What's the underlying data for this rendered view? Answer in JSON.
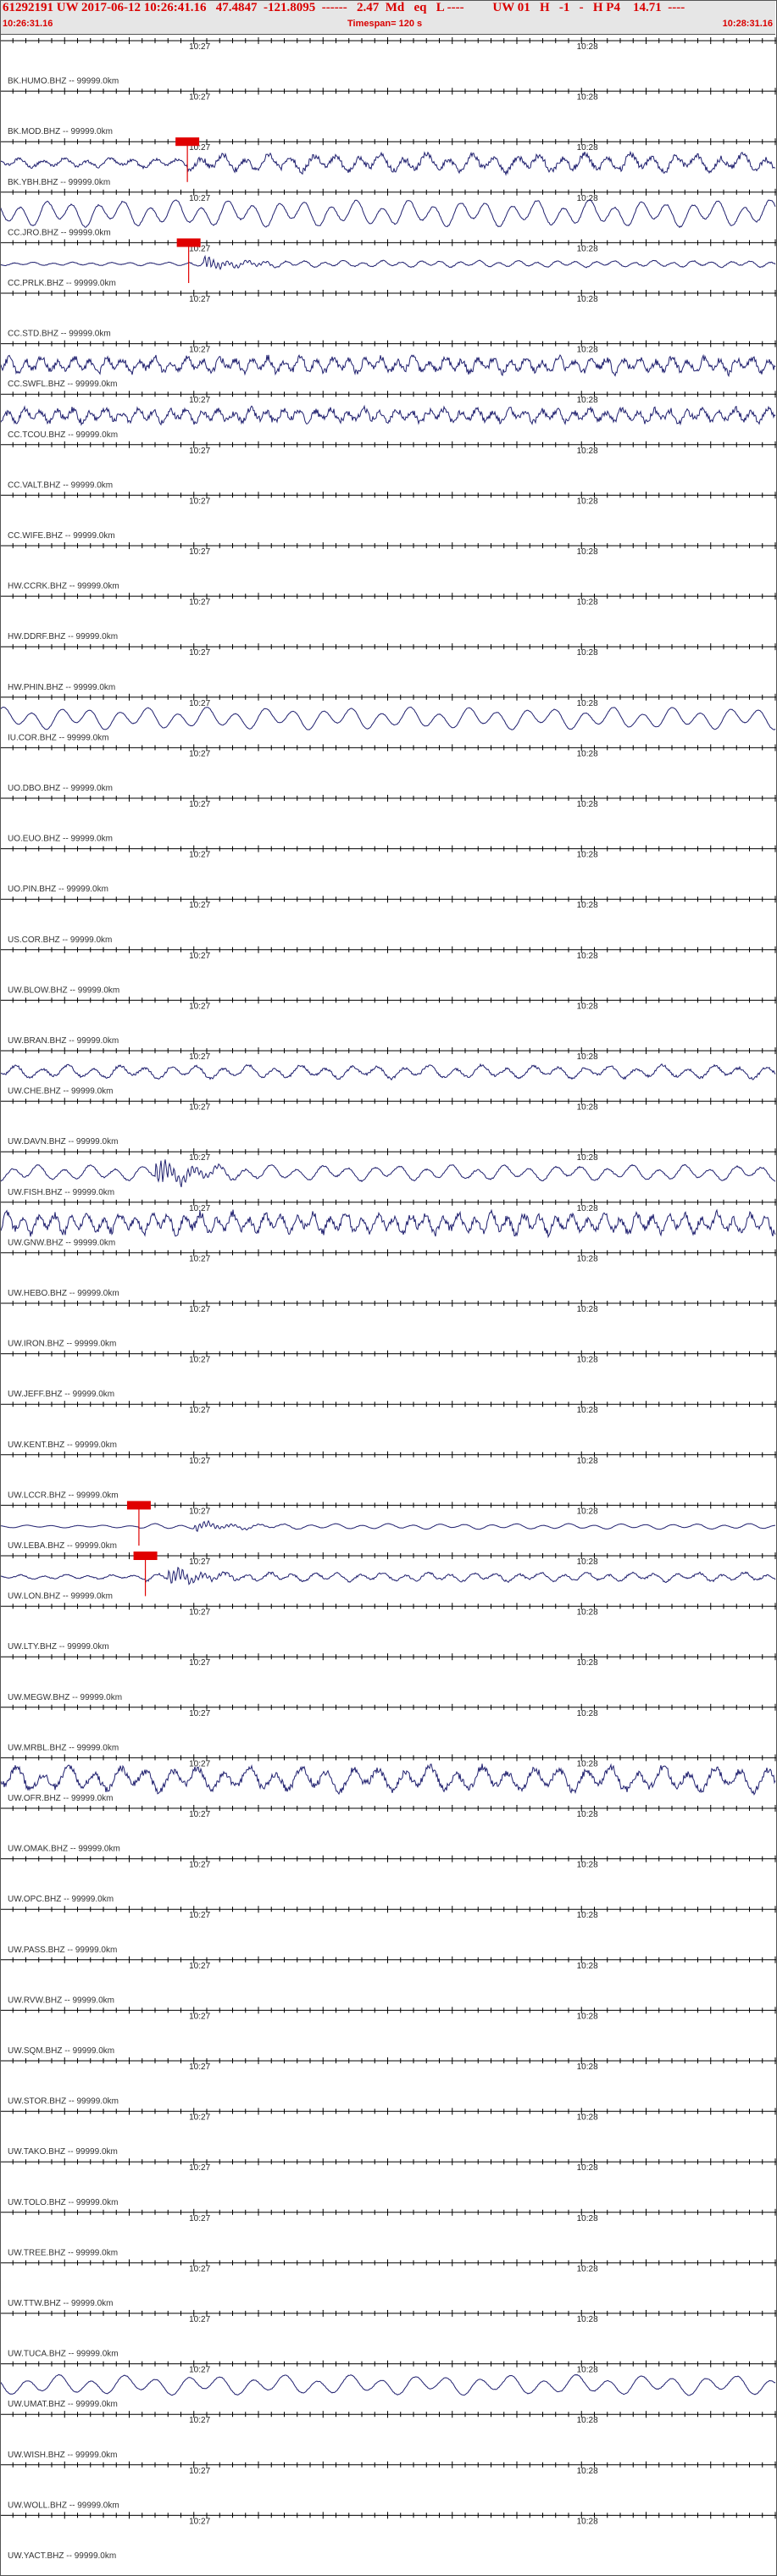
{
  "header": {
    "line": "61292191 UW 2017-06-12 10:26:41.16   47.4847  -121.8095  ------   2.47  Md   eq   L ----         UW 01   H   -1   -   H P4    14.71  ----",
    "start_time": "10:26:31.16",
    "timespan": "Timespan= 120 s",
    "end_time": "10:28:31.16"
  },
  "colors": {
    "header_text": "#d90000",
    "trace": "#1f1f6e",
    "pick": "#e00000",
    "axis": "#000000",
    "header_bg": "#e6e6e6"
  },
  "chart_data": {
    "type": "line",
    "title": "",
    "xlabel": "",
    "ylabel": "",
    "x_unit": "s",
    "xlim": [
      0,
      120
    ],
    "tick_labels": [
      {
        "time": "10:27",
        "x": 29
      },
      {
        "time": "10:28",
        "x": 89
      }
    ],
    "series": [
      {
        "name": "BK.HUMO.BHZ -- 99999.0km",
        "has_trace": false
      },
      {
        "name": "BK.MOD.BHZ -- 99999.0km",
        "has_trace": false
      },
      {
        "name": "BK.YBH.BHZ -- 99999.0km",
        "has_trace": true,
        "amp": 0.8,
        "period": 3.5,
        "noise": 0.35,
        "pick": {
          "x": 29.0
        }
      },
      {
        "name": "CC.JRO.BHZ -- 99999.0km",
        "has_trace": true,
        "amp": 1.2,
        "period": 4.0,
        "noise": 0.05
      },
      {
        "name": "CC.PRLK.BHZ -- 99999.0km",
        "has_trace": true,
        "amp": 0.3,
        "period": 3.0,
        "noise": 0.15,
        "pick": {
          "x": 29.2
        },
        "event": {
          "x": 31.5,
          "amp": 1.0
        }
      },
      {
        "name": "CC.STD.BHZ -- 99999.0km",
        "has_trace": false
      },
      {
        "name": "CC.SWFL.BHZ -- 99999.0km",
        "has_trace": true,
        "amp": 0.7,
        "period": 2.5,
        "noise": 0.45
      },
      {
        "name": "CC.TCOU.BHZ -- 99999.0km",
        "has_trace": true,
        "amp": 0.6,
        "period": 2.5,
        "noise": 0.5
      },
      {
        "name": "CC.VALT.BHZ -- 99999.0km",
        "has_trace": false
      },
      {
        "name": "CC.WIFE.BHZ -- 99999.0km",
        "has_trace": false
      },
      {
        "name": "HW.CCRK.BHZ -- 99999.0km",
        "has_trace": false
      },
      {
        "name": "HW.DDRF.BHZ -- 99999.0km",
        "has_trace": false
      },
      {
        "name": "HW.PHIN.BHZ -- 99999.0km",
        "has_trace": false
      },
      {
        "name": "IU.COR.BHZ -- 99999.0km",
        "has_trace": true,
        "amp": 1.0,
        "period": 4.5,
        "noise": 0.03
      },
      {
        "name": "UO.DBO.BHZ -- 99999.0km",
        "has_trace": false
      },
      {
        "name": "UO.EUO.BHZ -- 99999.0km",
        "has_trace": false
      },
      {
        "name": "UO.PIN.BHZ -- 99999.0km",
        "has_trace": false
      },
      {
        "name": "US.COR.BHZ -- 99999.0km",
        "has_trace": false
      },
      {
        "name": "UW.BLOW.BHZ -- 99999.0km",
        "has_trace": false
      },
      {
        "name": "UW.BRAN.BHZ -- 99999.0km",
        "has_trace": false
      },
      {
        "name": "UW.CHE.BHZ -- 99999.0km",
        "has_trace": true,
        "amp": 0.6,
        "period": 4.0,
        "noise": 0.2
      },
      {
        "name": "UW.DAVN.BHZ -- 99999.0km",
        "has_trace": false
      },
      {
        "name": "UW.FISH.BHZ -- 99999.0km",
        "has_trace": true,
        "amp": 0.7,
        "period": 4.0,
        "noise": 0.1,
        "event": {
          "x": 24.0,
          "amp": 0.9
        }
      },
      {
        "name": "UW.GNW.BHZ -- 99999.0km",
        "has_trace": true,
        "amp": 0.9,
        "period": 2.5,
        "noise": 0.4
      },
      {
        "name": "UW.HEBO.BHZ -- 99999.0km",
        "has_trace": false
      },
      {
        "name": "UW.IRON.BHZ -- 99999.0km",
        "has_trace": false
      },
      {
        "name": "UW.JEFF.BHZ -- 99999.0km",
        "has_trace": false
      },
      {
        "name": "UW.KENT.BHZ -- 99999.0km",
        "has_trace": false
      },
      {
        "name": "UW.LCCR.BHZ -- 99999.0km",
        "has_trace": false
      },
      {
        "name": "UW.LEBA.BHZ -- 99999.0km",
        "has_trace": true,
        "amp": 0.25,
        "period": 4.0,
        "noise": 0.05,
        "pick": {
          "x": 21.5
        },
        "event": {
          "x": 30.0,
          "amp": 0.8
        }
      },
      {
        "name": "UW.LON.BHZ -- 99999.0km",
        "has_trace": true,
        "amp": 0.4,
        "period": 3.5,
        "noise": 0.25,
        "pick": {
          "x": 22.5
        },
        "event": {
          "x": 26.0,
          "amp": 1.0
        }
      },
      {
        "name": "UW.LTY.BHZ -- 99999.0km",
        "has_trace": false
      },
      {
        "name": "UW.MEGW.BHZ -- 99999.0km",
        "has_trace": false
      },
      {
        "name": "UW.MRBL.BHZ -- 99999.0km",
        "has_trace": false
      },
      {
        "name": "UW.OFR.BHZ -- 99999.0km",
        "has_trace": true,
        "amp": 1.1,
        "period": 4.0,
        "noise": 0.3
      },
      {
        "name": "UW.OMAK.BHZ -- 99999.0km",
        "has_trace": false
      },
      {
        "name": "UW.OPC.BHZ -- 99999.0km",
        "has_trace": false
      },
      {
        "name": "UW.PASS.BHZ -- 99999.0km",
        "has_trace": false
      },
      {
        "name": "UW.RVW.BHZ -- 99999.0km",
        "has_trace": false
      },
      {
        "name": "UW.SQM.BHZ -- 99999.0km",
        "has_trace": false
      },
      {
        "name": "UW.STOR.BHZ -- 99999.0km",
        "has_trace": false
      },
      {
        "name": "UW.TAKO.BHZ -- 99999.0km",
        "has_trace": false
      },
      {
        "name": "UW.TOLO.BHZ -- 99999.0km",
        "has_trace": false
      },
      {
        "name": "UW.TREE.BHZ -- 99999.0km",
        "has_trace": false
      },
      {
        "name": "UW.TTW.BHZ -- 99999.0km",
        "has_trace": false
      },
      {
        "name": "UW.TUCA.BHZ -- 99999.0km",
        "has_trace": false
      },
      {
        "name": "UW.UMAT.BHZ -- 99999.0km",
        "has_trace": true,
        "amp": 0.9,
        "period": 5.0,
        "noise": 0.04
      },
      {
        "name": "UW.WISH.BHZ -- 99999.0km",
        "has_trace": false
      },
      {
        "name": "UW.WOLL.BHZ -- 99999.0km",
        "has_trace": false
      },
      {
        "name": "UW.YACT.BHZ -- 99999.0km",
        "has_trace": false
      }
    ]
  }
}
